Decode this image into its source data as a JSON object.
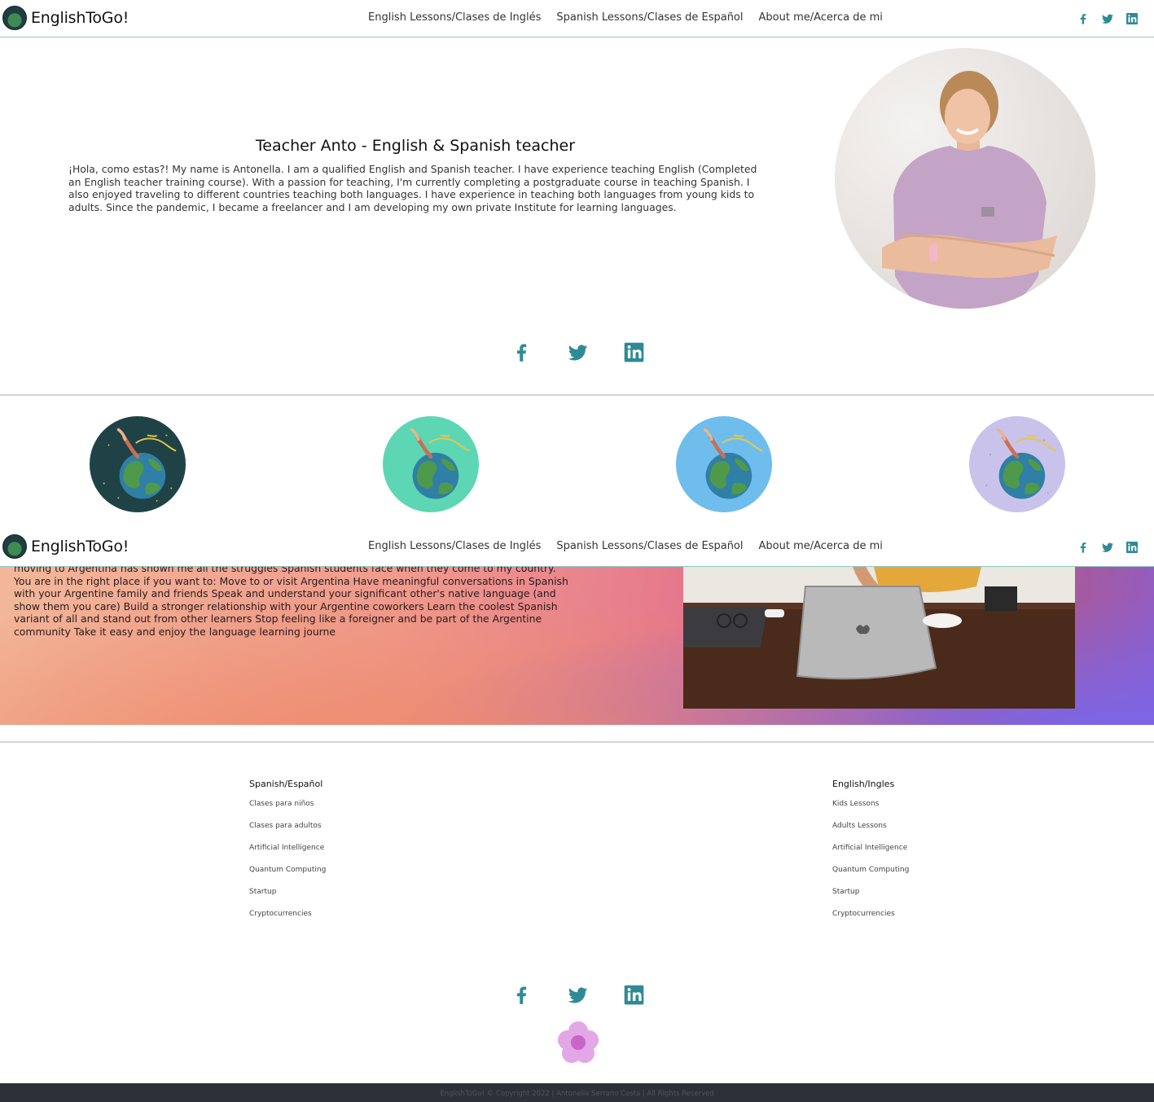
{
  "brand": {
    "name": "EnglishToGo!"
  },
  "nav": {
    "links": [
      "English Lessons/Clases de Inglés",
      "Spanish Lessons/Clases de Español",
      "About me/Acerca de mi"
    ],
    "social_icons": [
      "facebook-icon",
      "twitter-icon",
      "linkedin-icon"
    ]
  },
  "hero": {
    "title": "Teacher Anto - English & Spanish teacher",
    "text": "¡Hola, como estas?! My name is Antonella. I am a qualified English and Spanish teacher. I have experience teaching English (Completed an English teacher training course). With a passion for teaching, I'm currently completing a postgraduate course in teaching Spanish. I also enjoyed traveling to different countries teaching both languages. I have experience in teaching both languages from young kids to adults. Since the pandemic, I became a freelancer and I am developing my own private Institute for learning languages."
  },
  "gradient_section": {
    "text": "moving to Argentina has shown me all the struggles Spanish students face when they come to my country. You are in the right place if you want to: Move to or visit Argentina Have meaningful conversations in Spanish with your Argentine family and friends Speak and understand your significant other's native language (and show them you care) Build a stronger relationship with your Argentine coworkers Learn the coolest Spanish variant of all and stand out from other learners Stop feeling like a foreigner and be part of the Argentine community Take it easy and enjoy the language learning journe"
  },
  "footer": {
    "columns": [
      {
        "heading": "Spanish/Español",
        "links": [
          "Clases para niños",
          "Clases para adultos",
          "Artificial Intelligence",
          "Quantum Computing",
          "Startup",
          "Cryptocurrencies"
        ]
      },
      {
        "heading": "English/Ingles",
        "links": [
          "Kids Lessons",
          "Adults Lessons",
          "Artificial Intelligence",
          "Quantum Computing",
          "Startup",
          "Cryptocurrencies"
        ]
      }
    ],
    "copyright": "EnglishToGo! © Copyright 2022 | Antonella Serrano Costa | All Rights Reserved"
  },
  "colors": {
    "accent": "#2f8a96",
    "nav_border": "#8fc7c4",
    "footer_bar": "#2d3039",
    "badge_dark": "#1f4246",
    "badge_mint": "#5dd6b4",
    "badge_blue": "#6fbdec",
    "badge_lilac": "#c9c3eb",
    "flower": "#e3a6e6"
  }
}
